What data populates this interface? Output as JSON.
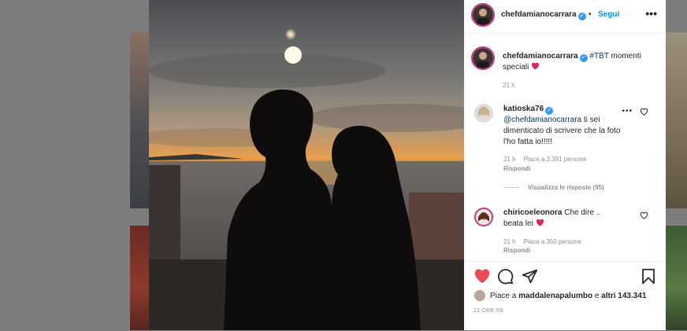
{
  "post": {
    "author": "chefdamianocarrara",
    "follow_label": "Segui",
    "header_separator": "•",
    "caption": {
      "username": "chefdamianocarrara",
      "hashtag": "#TBT",
      "text": " momenti speciali",
      "time": "21 h"
    },
    "comments": [
      {
        "username": "katioska76",
        "verified": true,
        "mention": "@chefdamianocarrara",
        "text": " ti sei dimenticato di scrivere che la foto l'ho fatta io!!!!!",
        "time": "21 h",
        "likes": "Piace a 3.391 persone",
        "reply_label": "Rispondi",
        "view_replies": "Visualizza le risposte (95)"
      },
      {
        "username": "chiricoeleonora",
        "verified": false,
        "text": " Che dire .. beata lei",
        "time": "21 h",
        "likes": "Piace a 350 persone",
        "reply_label": "Rispondi"
      }
    ],
    "liked_by_prefix": "Piace a ",
    "liked_by_user": "maddalenapalumbo",
    "liked_by_mid": " e ",
    "liked_by_others": "altri 143.341",
    "post_time": "21 ORE FA"
  },
  "colors": {
    "accent": "#0095f6",
    "like_red": "#ed4956",
    "verified_blue": "#3897f0",
    "text": "#262626",
    "muted": "#8e8e8e"
  },
  "icons": [
    "more-icon",
    "verified-icon",
    "heart-icon",
    "comment-icon",
    "share-icon",
    "bookmark-icon",
    "red-heart-emoji"
  ]
}
